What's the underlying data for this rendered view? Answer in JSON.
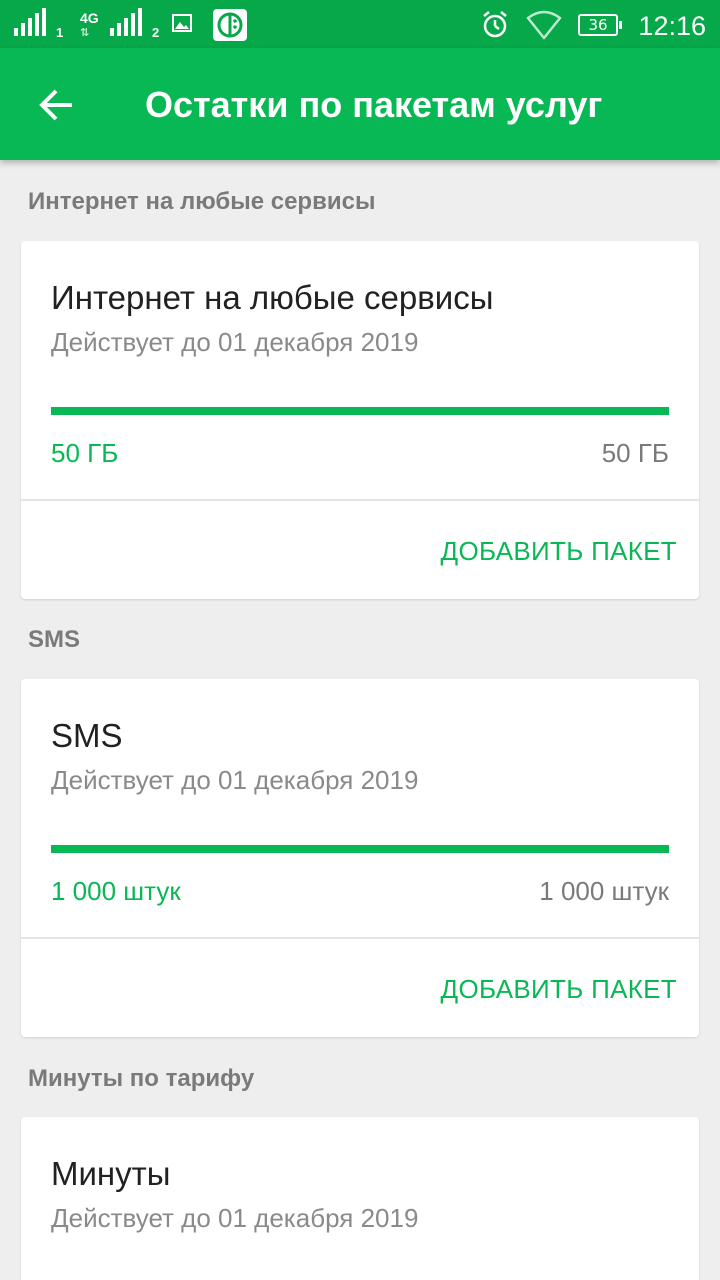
{
  "status_bar": {
    "sim1": "1",
    "network_type": "4G",
    "sim2": "2",
    "battery": "36",
    "time": "12:16",
    "icons": [
      "signal-icon",
      "image-icon",
      "app-icon",
      "alarm-icon",
      "wifi-icon",
      "battery-icon"
    ]
  },
  "app_bar": {
    "title": "Остатки по пакетам услуг",
    "back_icon": "arrow-back-icon"
  },
  "colors": {
    "accent": "#08b854",
    "status_bar": "#07a84a",
    "background": "#eeeeee"
  },
  "sections": [
    {
      "header": "Интернет на любые сервисы",
      "card": {
        "title": "Интернет на любые сервисы",
        "subtitle": "Действует до 01 декабря 2019",
        "remaining": "50 ГБ",
        "total": "50 ГБ",
        "progress_fraction": 1.0,
        "button": "ДОБАВИТЬ ПАКЕТ"
      }
    },
    {
      "header": "SMS",
      "card": {
        "title": "SMS",
        "subtitle": "Действует до 01 декабря 2019",
        "remaining": "1 000 штук",
        "total": "1 000 штук",
        "progress_fraction": 1.0,
        "button": "ДОБАВИТЬ ПАКЕТ"
      }
    },
    {
      "header": "Минуты по тарифу",
      "card": {
        "title": "Минуты",
        "subtitle": "Действует до 01 декабря 2019"
      }
    }
  ]
}
